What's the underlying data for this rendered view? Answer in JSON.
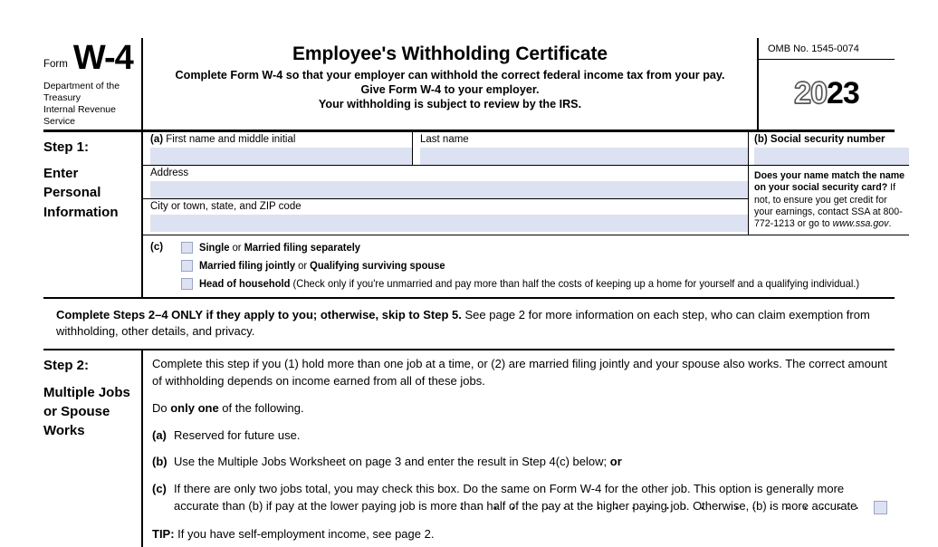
{
  "header": {
    "form_label": "Form",
    "form_number": "W-4",
    "department_line1": "Department of the Treasury",
    "department_line2": "Internal Revenue Service",
    "title": "Employee's Withholding Certificate",
    "sub_line1": "Complete Form W-4 so that your employer can withhold the correct federal income tax from your pay.",
    "sub_line2": "Give Form W-4 to your employer.",
    "sub_line3": "Your withholding is subject to review by the IRS.",
    "omb": "OMB No. 1545-0074",
    "year_prefix": "20",
    "year_suffix": "23"
  },
  "step1": {
    "title": "Step 1:",
    "subtitle_line1": "Enter",
    "subtitle_line2": "Personal",
    "subtitle_line3": "Information",
    "tag_a": "(a)",
    "first_name_label": "First name and middle initial",
    "first_name_value": "",
    "last_name_label": "Last name",
    "last_name_value": "",
    "address_label": "Address",
    "address_value": "",
    "city_label": "City or town, state, and ZIP code",
    "city_value": "",
    "tag_b": "(b)",
    "ssn_label": "Social security number",
    "ssn_value": "",
    "ssn_note_bold": "Does your name match the name on your social security card?",
    "ssn_note_rest": " If not, to ensure you get credit for your earnings, contact SSA at 800-772-1213 or go to ",
    "ssn_note_italic": "www.ssa.gov",
    "ssn_note_end": ".",
    "tag_c": "(c)",
    "filing_status": [
      {
        "bold": "Single",
        "rest": " or ",
        "bold2": "Married filing separately",
        "rest2": ""
      },
      {
        "bold": "Married filing jointly",
        "rest": " or ",
        "bold2": "Qualifying surviving spouse",
        "rest2": ""
      },
      {
        "bold": "Head of household",
        "rest": " (Check only if you're unmarried and pay more than half the costs of keeping up a home for yourself and a qualifying individual.)",
        "bold2": "",
        "rest2": ""
      }
    ]
  },
  "midnote": {
    "bold": "Complete Steps 2–4 ONLY if they apply to you; otherwise, skip to Step 5.",
    "rest": " See page 2 for more information on each step, who can claim exemption from withholding, other details, and privacy."
  },
  "step2": {
    "title": "Step 2:",
    "subtitle_line1": "Multiple Jobs",
    "subtitle_line2": "or Spouse",
    "subtitle_line3": "Works",
    "intro": "Complete this step if you (1) hold more than one job at a time, or (2) are married filing jointly and your spouse also works. The correct amount of withholding depends on income earned from all of these jobs.",
    "do_one_pre": "Do ",
    "do_one_bold": "only one",
    "do_one_post": " of the following.",
    "item_a_tag": "(a)",
    "item_a_text": "Reserved for future use.",
    "item_b_tag": "(b)",
    "item_b_text": "Use the Multiple Jobs Worksheet on page 3 and enter the result in Step 4(c) below; ",
    "item_b_bold_tail": "or",
    "item_c_tag": "(c)",
    "item_c_text": "If there are only two jobs total, you may check this box. Do the same on Form W-4 for the other job. This option is generally more accurate than (b) if pay at the lower paying job is more than half of the pay at the higher paying job. Otherwise, (b) is more accurate",
    "item_c_checked": false,
    "tip_bold": "TIP:",
    "tip_rest": " If you have self-employment income, see page 2."
  },
  "colors": {
    "field_fill": "#dde2f2",
    "field_border": "#9aa3c4",
    "rule": "#000000"
  }
}
